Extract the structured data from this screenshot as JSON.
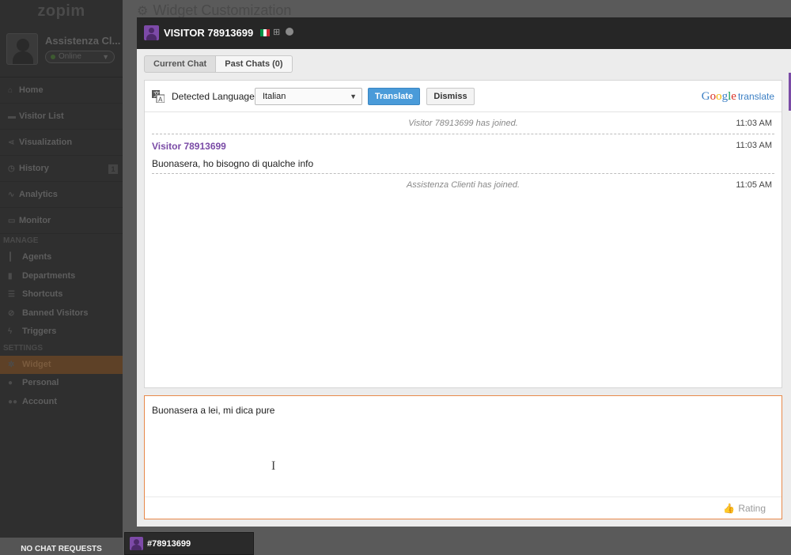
{
  "app": {
    "logo": "zopim",
    "page_title": "Widget Customization"
  },
  "profile": {
    "name": "Assistenza Cl...",
    "status": "Online"
  },
  "nav": {
    "items": [
      {
        "label": "Home",
        "icon": "home-icon"
      },
      {
        "label": "Visitor List",
        "icon": "chat-icon"
      },
      {
        "label": "Visualization",
        "icon": "share-icon"
      },
      {
        "label": "History",
        "icon": "clock-icon",
        "badge": "1"
      },
      {
        "label": "Analytics",
        "icon": "chart-icon"
      },
      {
        "label": "Monitor",
        "icon": "monitor-icon"
      }
    ],
    "manage_heading": "MANAGE",
    "manage_items": [
      {
        "label": "Agents",
        "icon": "agent-icon"
      },
      {
        "label": "Departments",
        "icon": "building-icon"
      },
      {
        "label": "Shortcuts",
        "icon": "list-icon"
      },
      {
        "label": "Banned Visitors",
        "icon": "ban-icon"
      },
      {
        "label": "Triggers",
        "icon": "bolt-icon"
      }
    ],
    "settings_heading": "SETTINGS",
    "settings_items": [
      {
        "label": "Widget",
        "icon": "gear-icon"
      },
      {
        "label": "Personal",
        "icon": "person-icon"
      },
      {
        "label": "Account",
        "icon": "group-icon"
      }
    ]
  },
  "bottom_bar": {
    "label": "NO CHAT REQUESTS"
  },
  "chat": {
    "title": "VISITOR 78913699",
    "flag_colors": [
      "#009246",
      "#ffffff",
      "#ce2b37"
    ],
    "tabs": [
      {
        "label": "Current Chat"
      },
      {
        "label": "Past Chats (0)"
      }
    ],
    "translate": {
      "label": "Detected Language",
      "selected_language": "Italian",
      "translate_button": "Translate",
      "dismiss_button": "Dismiss",
      "brand": "Google",
      "brand_suffix": "translate"
    },
    "messages": [
      {
        "type": "system",
        "text": "Visitor 78913699 has joined.",
        "time": "11:03 AM"
      },
      {
        "type": "message",
        "author": "Visitor 78913699",
        "text": "Buonasera, ho bisogno di qualche info",
        "time": "11:03 AM"
      },
      {
        "type": "system",
        "text": "Assistenza Clienti has joined.",
        "time": "11:05 AM"
      }
    ],
    "input": {
      "value": "Buonasera a lei, mi dica pure"
    },
    "rating_label": "Rating"
  },
  "chat_tab": {
    "label": "#78913699"
  }
}
